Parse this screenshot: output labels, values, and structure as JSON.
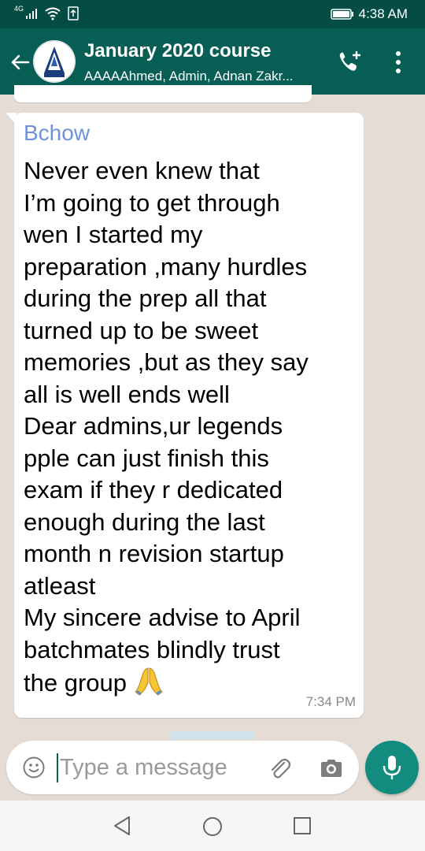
{
  "status_bar": {
    "network": "4G",
    "time": "4:38 AM",
    "icons": [
      "signal-icon",
      "wifi-icon",
      "upload-icon",
      "battery-icon"
    ]
  },
  "header": {
    "title": "January 2020 course",
    "subtitle": "AAAAAhmed, Admin, Adnan Zakr...",
    "icons": [
      "back-arrow-icon",
      "group-avatar",
      "add-call-icon",
      "more-options-icon"
    ]
  },
  "message": {
    "sender": "Bchow",
    "text": "Never even knew that\nI’m going to get through\nwen I started my\npreparation ,many hurdles\nduring the prep all that\nturned up to be sweet\nmemories ,but as they say\nall is well ends well\nDear admins,ur legends\npple can just finish this\nexam if they r dedicated\nenough during the last\nmonth n revision startup\natleast\nMy sincere advise to April\nbatchmates blindly trust\nthe group",
    "emoji": "🙏",
    "time": "7:34 PM",
    "sender_color": "#6f93d8"
  },
  "composer": {
    "placeholder": "Type a message",
    "value": "",
    "icons": [
      "emoji-icon",
      "attach-icon",
      "camera-icon",
      "mic-icon"
    ]
  },
  "nav_bar": {
    "icons": [
      "nav-back-icon",
      "nav-home-icon",
      "nav-recents-icon"
    ]
  },
  "colors": {
    "status_bar": "#054d44",
    "header": "#075e54",
    "chat_background": "#e5ddd5",
    "accent": "#128c7e"
  }
}
